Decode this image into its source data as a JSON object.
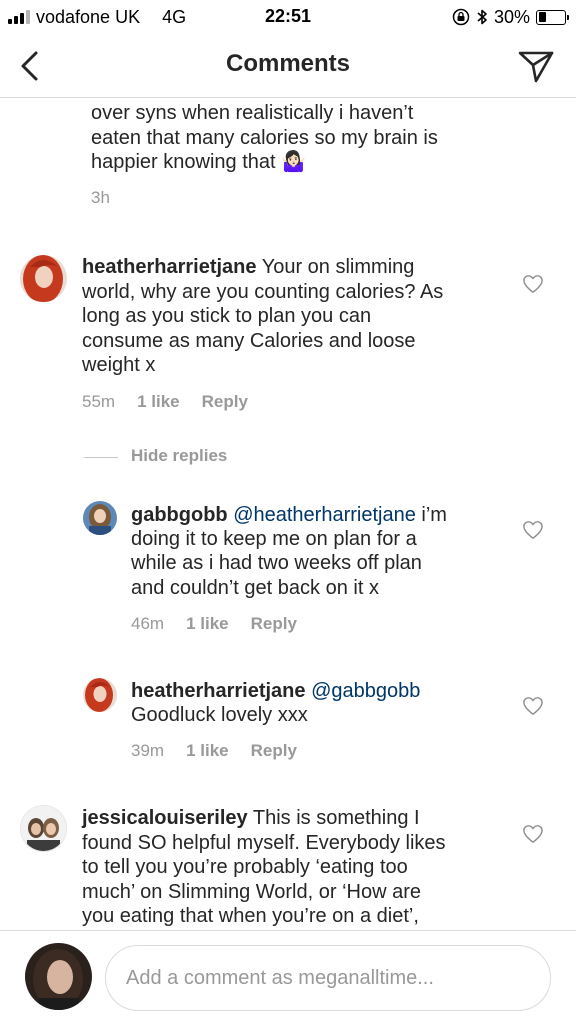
{
  "status_bar": {
    "carrier": "vodafone UK",
    "network": "4G",
    "time": "22:51",
    "battery_percent": "30%",
    "battery_level": 0.3,
    "icons": [
      "signal-icon",
      "orientation-lock-icon",
      "bluetooth-icon",
      "battery-icon"
    ]
  },
  "header": {
    "title": "Comments",
    "back_icon": "chevron-left-icon",
    "send_icon": "paper-plane-icon"
  },
  "comments": [
    {
      "text_lines": [
        "over syns when realistically i haven’t",
        "eaten that many calories so my brain is",
        "happier knowing that 🤷🏻‍♀️"
      ],
      "time": "3h"
    },
    {
      "username": "heatherharrietjane",
      "text": "Your on slimming world, why are you counting calories? As long as you stick to plan you can consume as many Calories and loose weight x",
      "line1_rest": "Your on slimming",
      "lines": [
        "world, why are you counting calories? As",
        "long as you stick to plan you can",
        "consume as many Calories and loose",
        "weight x"
      ],
      "time": "55m",
      "likes": "1 like",
      "reply": "Reply",
      "hide_replies": "Hide replies",
      "replies": [
        {
          "username": "gabbgobb",
          "mention": "@heatherharrietjane",
          "line1_rest": "i’m",
          "lines": [
            "doing it to keep me on plan for a",
            "while as i had two weeks off plan",
            "and couldn’t get back on it x"
          ],
          "time": "46m",
          "likes": "1 like",
          "reply": "Reply"
        },
        {
          "username": "heatherharrietjane",
          "mention": "@gabbgobb",
          "lines": [
            "Goodluck lovely xxx"
          ],
          "time": "39m",
          "likes": "1 like",
          "reply": "Reply"
        }
      ]
    },
    {
      "username": "jessicalouiseriley",
      "line1_rest": "This is something I",
      "lines": [
        "found SO helpful myself. Everybody likes",
        "to tell you you’re probably ‘eating too",
        "much’ on Slimming World, or ‘How are",
        "you eating that when you’re on a diet’,"
      ]
    }
  ],
  "footer": {
    "placeholder": "Add a comment as meganalltime..."
  },
  "colors": {
    "text": "#262626",
    "secondary": "#999999",
    "mention": "#003569",
    "divider": "#dbdbdb"
  }
}
